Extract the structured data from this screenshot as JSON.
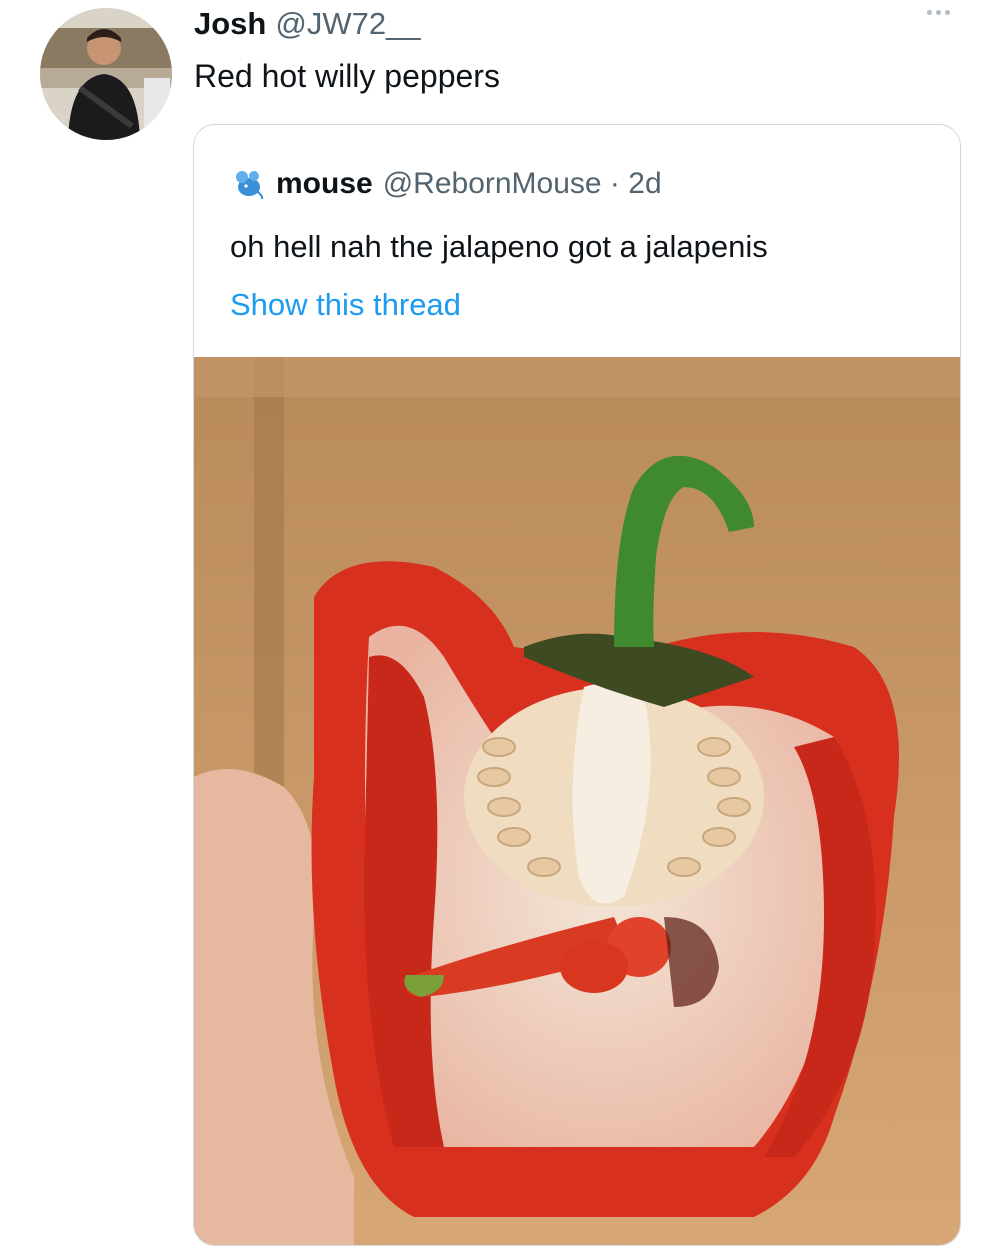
{
  "tweet": {
    "display_name": "Josh",
    "handle": "@JW72__",
    "text": "Red hot willy peppers",
    "more_icon": "more-options-icon"
  },
  "quoted_tweet": {
    "display_name": "mouse",
    "handle_time": "@RebornMouse · 2d",
    "text": "oh hell nah the jalapeno got a jalapenis",
    "show_thread": "Show this thread",
    "link_color": "#1d9bf0",
    "media_description_icon": "photo"
  },
  "colors": {
    "text_primary": "#0f1419",
    "text_secondary": "#536471",
    "border": "#cfd9de",
    "link": "#1d9bf0"
  }
}
